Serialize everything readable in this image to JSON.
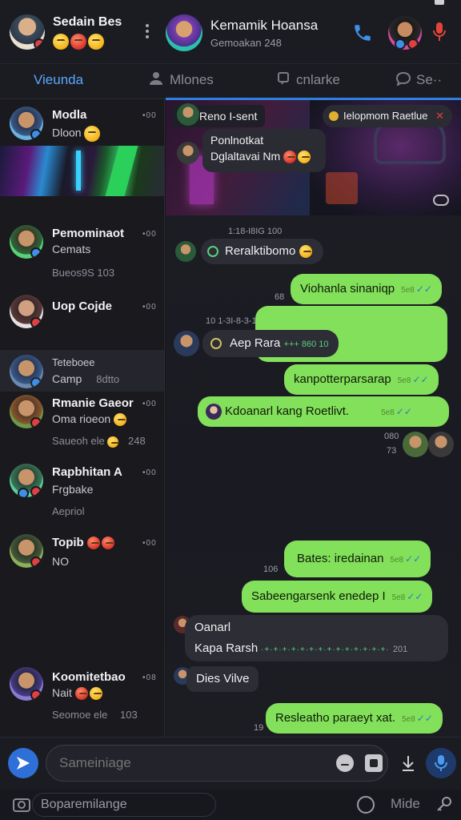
{
  "header": {
    "left_user": {
      "name": "Sedain Bes"
    },
    "chat_title": "Kemamik Hoansa",
    "chat_subtitle": "Gemoakan 248"
  },
  "tabs": [
    {
      "label": "Vieunda",
      "active": true
    },
    {
      "label": "Mlones",
      "active": false
    },
    {
      "label": "cnlarke",
      "active": false
    },
    {
      "label": "Se··",
      "active": false
    }
  ],
  "sidebar": {
    "chats": [
      {
        "name": "Modla",
        "sub": "Dloon",
        "time": "•00"
      },
      {
        "name": "Pemominaot",
        "sub": "Cemats",
        "meta": "Bueos9S 103",
        "time": "•00"
      },
      {
        "name": "Uop Cojde",
        "time": "•00"
      },
      {
        "name": "Teteboee",
        "sub": "Camp",
        "meta_right": "8dtto"
      },
      {
        "name": "Rmanie Gaeor",
        "sub": "Oma rioeon",
        "meta": "Saueoh ele",
        "time2": "248",
        "time": "•00"
      },
      {
        "name": "Rapbhitan A",
        "sub": "Frgbake",
        "meta": "Aepriol",
        "time": "•00"
      },
      {
        "name": "Topib",
        "sub": "NO",
        "time": "•00"
      },
      {
        "name": "Koomitetbao",
        "sub": "Nait",
        "meta": "Seomoe ele",
        "time2": "103",
        "time": "•08"
      }
    ]
  },
  "chat": {
    "banner": {
      "pill_left": "Reno I-sent",
      "pill_right": "Ielopmom Raetlue",
      "card_title": "Ponlnotkat",
      "card_sub": "Dglaltavai Nm"
    },
    "messages": [
      {
        "dir": "time",
        "text": "1:18-I8IG 100"
      },
      {
        "dir": "in",
        "text": "Reralktibomo"
      },
      {
        "dir": "out",
        "text": "Viohanla sinaniqp",
        "time": "5e8",
        "pre": "68"
      },
      {
        "dir": "time",
        "text": "10 1-3I-8-3-12"
      },
      {
        "dir": "in",
        "text": "Aep Rara",
        "extra": "+++ 860 10"
      },
      {
        "dir": "out",
        "text": "kanpotterparsarap",
        "time": "5e8"
      },
      {
        "dir": "out",
        "text": "Kdoanarl kang Roetlivt.",
        "time": "5e8"
      },
      {
        "dir": "time",
        "text": "080"
      },
      {
        "dir": "time",
        "text": "73"
      },
      {
        "dir": "out",
        "text": "Bates: iredainan",
        "time": "5e8",
        "pre": "106"
      },
      {
        "dir": "out",
        "text": "Sabeengarsenk enedep I",
        "time": "5e8"
      },
      {
        "dir": "in",
        "text": "Oanarl",
        "text2": "Kapa Rarsh",
        "time": "201"
      },
      {
        "dir": "in",
        "text": "Dies Vilve"
      },
      {
        "dir": "out",
        "text": "Resleatho paraeyt xat.",
        "time": "5e8",
        "pre": "19"
      }
    ]
  },
  "composer": {
    "placeholder": "Sameiniage"
  },
  "bottombar": {
    "field": "Boparemilange",
    "right_label": "Mide"
  },
  "colors": {
    "accent": "#2f7fe0",
    "outgoing": "#83e05a",
    "incoming": "#2c2d35",
    "background": "#17181d"
  }
}
